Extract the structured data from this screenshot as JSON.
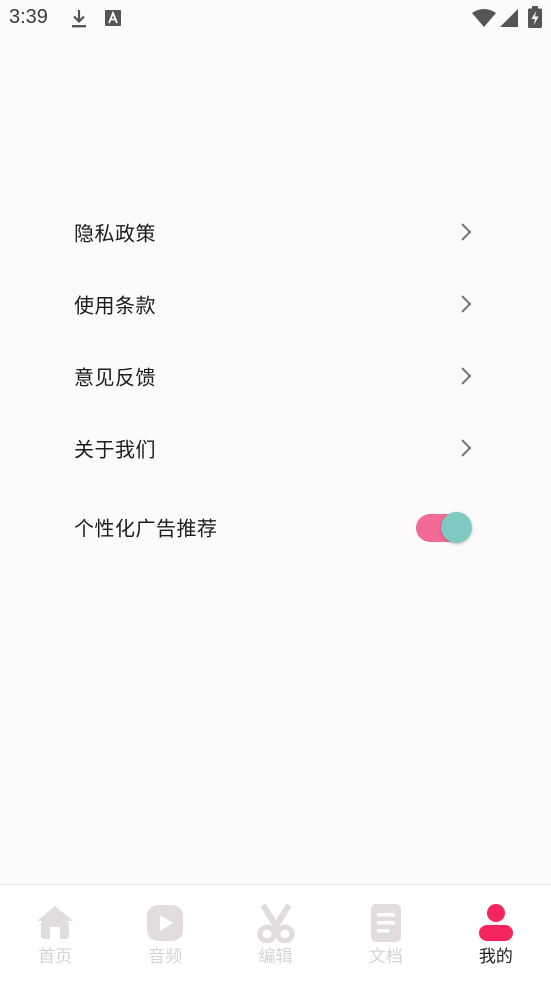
{
  "status_bar": {
    "time": "3:39",
    "icons": [
      "download-icon",
      "text-a-icon",
      "wifi-icon",
      "signal-icon",
      "battery-charging-icon"
    ]
  },
  "settings": {
    "items": [
      {
        "label": "隐私政策",
        "icon": "chevron-right-icon"
      },
      {
        "label": "使用条款",
        "icon": "chevron-right-icon"
      },
      {
        "label": "意见反馈",
        "icon": "chevron-right-icon"
      },
      {
        "label": "关于我们",
        "icon": "chevron-right-icon"
      }
    ],
    "toggle": {
      "label": "个性化广告推荐",
      "on": true
    }
  },
  "bottom_nav": {
    "items": [
      {
        "label": "首页",
        "icon": "home-icon",
        "active": false
      },
      {
        "label": "音频",
        "icon": "play-icon",
        "active": false
      },
      {
        "label": "编辑",
        "icon": "scissors-icon",
        "active": false
      },
      {
        "label": "文档",
        "icon": "document-icon",
        "active": false
      },
      {
        "label": "我的",
        "icon": "person-icon",
        "active": true
      }
    ]
  },
  "colors": {
    "background": "#fdfafb",
    "accent": "#f5245f",
    "toggle_track": "#f26a96",
    "toggle_thumb": "#7ec9c0",
    "nav_inactive": "#e2dcdc"
  }
}
